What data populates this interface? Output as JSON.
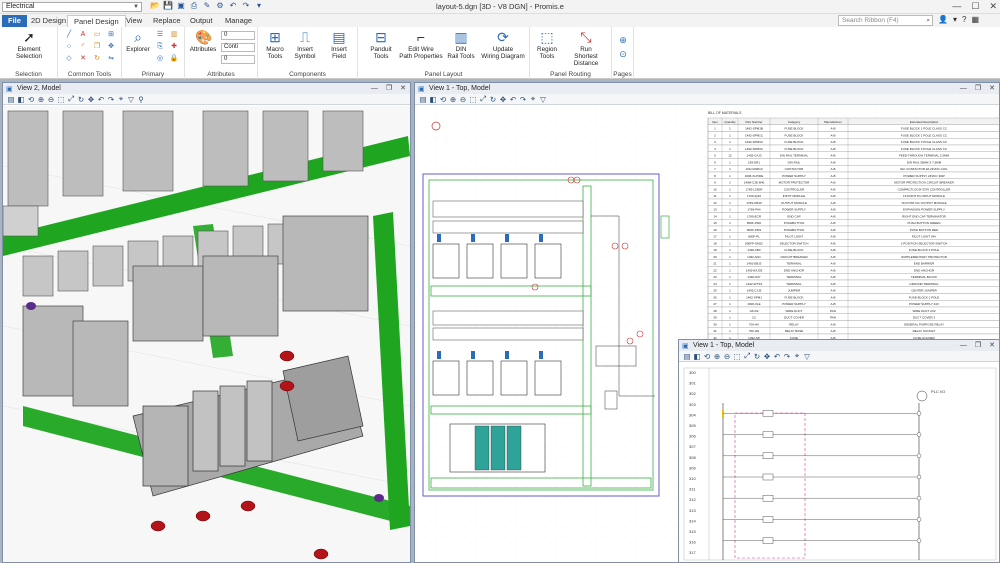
{
  "app": {
    "workspace": "Electrical",
    "window_title": "layout-5.dgn [3D - V8 DGN] - Promis.e",
    "search_placeholder": "Search Ribbon (F4)"
  },
  "tabs": [
    {
      "label": "File"
    },
    {
      "label": "2D Design"
    },
    {
      "label": "Panel Design"
    },
    {
      "label": "View"
    },
    {
      "label": "Replace"
    },
    {
      "label": "Output"
    },
    {
      "label": "Manage"
    }
  ],
  "ribbon": {
    "selection": {
      "label": "Selection",
      "element_selection": "Element\nSelection"
    },
    "common_tools": {
      "label": "Common Tools"
    },
    "primary": {
      "label": "Primary",
      "explorer": "Explorer"
    },
    "attributes": {
      "label": "Attributes",
      "attributes_btn": "Attributes",
      "level_value": "0",
      "style_value": "Conti",
      "weight_value": "0"
    },
    "components": {
      "label": "Components",
      "macro_tools": "Macro\nTools",
      "insert_symbol": "Insert\nSymbol",
      "insert_field": "Insert\nField"
    },
    "panel_layout": {
      "label": "Panel Layout",
      "panduit_tools": "Panduit\nTools",
      "edit_wire_path": "Edit Wire\nPath Properties",
      "din_rail_tools": "DIN\nRail Tools",
      "update_wiring": "Update\nWiring Diagram"
    },
    "panel_routing": {
      "label": "Panel Routing",
      "region_tools": "Region\nTools",
      "run_shortest": "Run\nShortest Distance"
    },
    "pages": {
      "label": "Pages"
    }
  },
  "views": {
    "view2_title": "View 2, Model",
    "view1_title": "View 1 - Top, Model",
    "view1b_title": "View 1 - Top, Model"
  },
  "bom": {
    "title": "BILL OF MATERIALS",
    "headers": [
      "Item",
      "Quantity",
      "Part Number",
      "Category",
      "Manufacturer",
      "Extended Description"
    ],
    "rows": [
      [
        "1",
        "1",
        "1492-SPM1B",
        "FUSE BLOCK",
        "A-B",
        "FUSE BLOCK 1 POLE CLASS CC"
      ],
      [
        "2",
        "1",
        "1492-SPM1C",
        "FUSE BLOCK",
        "A-B",
        "FUSE BLOCK 1 POLE CLASS CC"
      ],
      [
        "3",
        "1",
        "1492-SPM3C",
        "FUSE BLOCK",
        "A-B",
        "FUSE BLOCK 3 POLE CLASS CC"
      ],
      [
        "4",
        "1",
        "1492-SPM3C",
        "FUSE BLOCK",
        "A-B",
        "FUSE BLOCK 3 POLE CLASS CC"
      ],
      [
        "5",
        "12",
        "1492-CAJ3",
        "DIN RAIL TERMINAL",
        "A-B",
        "FEED-THROUGH TERMINAL 2.5MM"
      ],
      [
        "6",
        "1",
        "199-DR1",
        "DIN RAIL",
        "A-B",
        "DIN RAIL 35MM X 7.5MM"
      ],
      [
        "7",
        "1",
        "100-C09D10",
        "CONTACTOR",
        "A-B",
        "IEC CONTACTOR 9A 24VDC COIL"
      ],
      [
        "8",
        "1",
        "1606-XLP30E",
        "POWER SUPPLY",
        "A-B",
        "POWER SUPPLY 24VDC 30W"
      ],
      [
        "9",
        "1",
        "140M-C2E-B40",
        "MOTOR PROTECTOR",
        "A-B",
        "MOTOR PROTECTION CIRCUIT BREAKER"
      ],
      [
        "10",
        "1",
        "1769-L33ER",
        "CONTROLLER",
        "A-B",
        "COMPACTLOGIX 5370 CONTROLLER"
      ],
      [
        "11",
        "1",
        "1769-IQ16",
        "INPUT MODULE",
        "A-B",
        "16 POINT DC INPUT MODULE"
      ],
      [
        "12",
        "1",
        "1769-OB16",
        "OUTPUT MODULE",
        "A-B",
        "16 POINT DC OUTPUT MODULE"
      ],
      [
        "13",
        "1",
        "1769-PA4",
        "POWER SUPPLY",
        "A-B",
        "EXPANSION POWER SUPPLY"
      ],
      [
        "14",
        "1",
        "1769-ECR",
        "END CAP",
        "A-B",
        "RIGHT END CAP TERMINATOR"
      ],
      [
        "15",
        "1",
        "800F-PM2",
        "PUSHBUTTON",
        "A-B",
        "PUSH BUTTON GREEN"
      ],
      [
        "16",
        "1",
        "800F-PM3",
        "PUSHBUTTON",
        "A-B",
        "PUSH BUTTON RED"
      ],
      [
        "17",
        "1",
        "800F-PL",
        "PILOT LIGHT",
        "A-B",
        "PILOT LIGHT 24V"
      ],
      [
        "18",
        "1",
        "800FP-SM22",
        "SELECTOR SWITCH",
        "A-B",
        "2 POSITION SELECTOR SWITCH"
      ],
      [
        "19",
        "1",
        "1492-FB3",
        "FUSE BLOCK",
        "A-B",
        "FUSE BLOCK 3 POLE"
      ],
      [
        "20",
        "1",
        "1492-GS1",
        "CIRCUIT BREAKER",
        "A-B",
        "SUPPLEMENTARY PROTECTOR"
      ],
      [
        "21",
        "1",
        "1492-EBJ3",
        "TERMINAL",
        "A-B",
        "END BARRIER"
      ],
      [
        "22",
        "1",
        "1492-EAJ35",
        "END ANCHOR",
        "A-B",
        "END ANCHOR"
      ],
      [
        "23",
        "1",
        "1492-N27",
        "TERMINAL",
        "A-B",
        "TERMINAL BLOCK"
      ],
      [
        "24",
        "1",
        "1492-WTS3",
        "TERMINAL",
        "A-B",
        "GROUND TERMINAL"
      ],
      [
        "25",
        "1",
        "1492-CJJ5",
        "JUMPER",
        "A-B",
        "CENTER JUMPER"
      ],
      [
        "26",
        "1",
        "1492-SPM1",
        "FUSE BLOCK",
        "A-B",
        "FUSE BLOCK 1 POLE"
      ],
      [
        "27",
        "1",
        "1606-XLE",
        "POWER SUPPLY",
        "A-B",
        "POWER SUPPLY 24V"
      ],
      [
        "28",
        "1",
        "G6-D2",
        "WIRE DUCT",
        "PAN",
        "WIRE DUCT 2X2"
      ],
      [
        "29",
        "1",
        "C2",
        "DUCT COVER",
        "PAN",
        "DUCT COVER 2"
      ],
      [
        "30",
        "1",
        "700-HK",
        "RELAY",
        "A-B",
        "GENERAL PURPOSE RELAY"
      ],
      [
        "31",
        "1",
        "700-HN",
        "RELAY BASE",
        "A-B",
        "RELAY SOCKET"
      ],
      [
        "32",
        "1",
        "1492-SP",
        "FUSE",
        "A-B",
        "FUSE HOLDER"
      ],
      [
        "33",
        "1",
        "1492-J4",
        "TERMINAL",
        "A-B",
        "TERMINAL BLOCK 4MM"
      ],
      [
        "34",
        "1",
        "855T-B",
        "STACK LIGHT",
        "A-B",
        "STACK LIGHT BASE"
      ],
      [
        "35",
        "1",
        "1492-MJ6",
        "TERMINAL",
        "A-B",
        "MARKER"
      ],
      [
        "36",
        "1",
        "1492-N21",
        "TERMINAL",
        "A-B",
        "TERMINAL 4 WIRE"
      ]
    ]
  },
  "schematic": {
    "line_numbers": [
      "300",
      "301",
      "302",
      "303",
      "304",
      "305",
      "306",
      "307",
      "308",
      "309",
      "310",
      "311",
      "312",
      "313",
      "314",
      "315",
      "316",
      "317"
    ],
    "title_block": "PLC I/O"
  },
  "colors": {
    "accent": "#2b6cb8",
    "green_duct": "#1fa51f",
    "model_gray": "#c9c9c9",
    "view_bg": "#ffffff"
  }
}
